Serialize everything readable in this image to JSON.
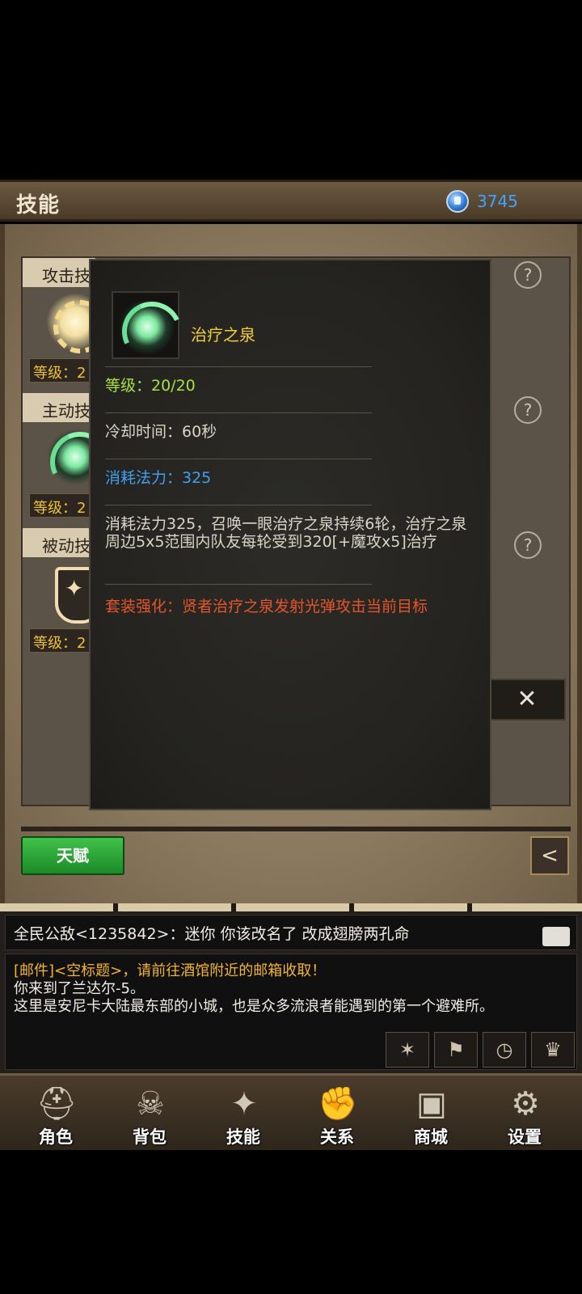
{
  "header": {
    "title": "技能",
    "gem_count": "3745"
  },
  "skill_rows": [
    {
      "label": "攻击技",
      "level": "等级：2",
      "help": "?"
    },
    {
      "label": "主动技",
      "level": "等级：2",
      "help": "?"
    },
    {
      "label": "被动技",
      "level": "等级：2",
      "help": "?"
    }
  ],
  "tooltip": {
    "name": "治疗之泉",
    "level": "等级：20/20",
    "cooldown": "冷却时间：60秒",
    "mana": "消耗法力：325",
    "description": "消耗法力325，召唤一眼治疗之泉持续6轮，治疗之泉周边5x5范围内队友每轮受到320[+魔攻x5]治疗",
    "set_bonus": "套装强化：贤者治疗之泉发射光弹攻击当前目标"
  },
  "buttons": {
    "close": "✕",
    "talent": "天赋",
    "back": "<"
  },
  "chat": {
    "world_line": "全民公敌<1235842>：迷你  你该改名了 改成翅膀两孔命",
    "mail_line": "[邮件]<空标题>，请前往酒馆附近的邮箱收取！",
    "messages": "你来到了兰达尔-5。\n这里是安尼卡大陆最东部的小城，也是众多流浪者能遇到的第一个避难所。"
  },
  "nav": [
    {
      "label": "角色",
      "icon": "helmet-icon"
    },
    {
      "label": "背包",
      "icon": "backpack-icon"
    },
    {
      "label": "技能",
      "icon": "skill-book-icon"
    },
    {
      "label": "关系",
      "icon": "handshake-icon"
    },
    {
      "label": "商城",
      "icon": "chest-icon"
    },
    {
      "label": "设置",
      "icon": "gear-icon"
    }
  ],
  "colors": {
    "gold": "#f2cf3a",
    "green": "#a8e040",
    "blue": "#3fa0f2",
    "orange": "#e4552a"
  }
}
